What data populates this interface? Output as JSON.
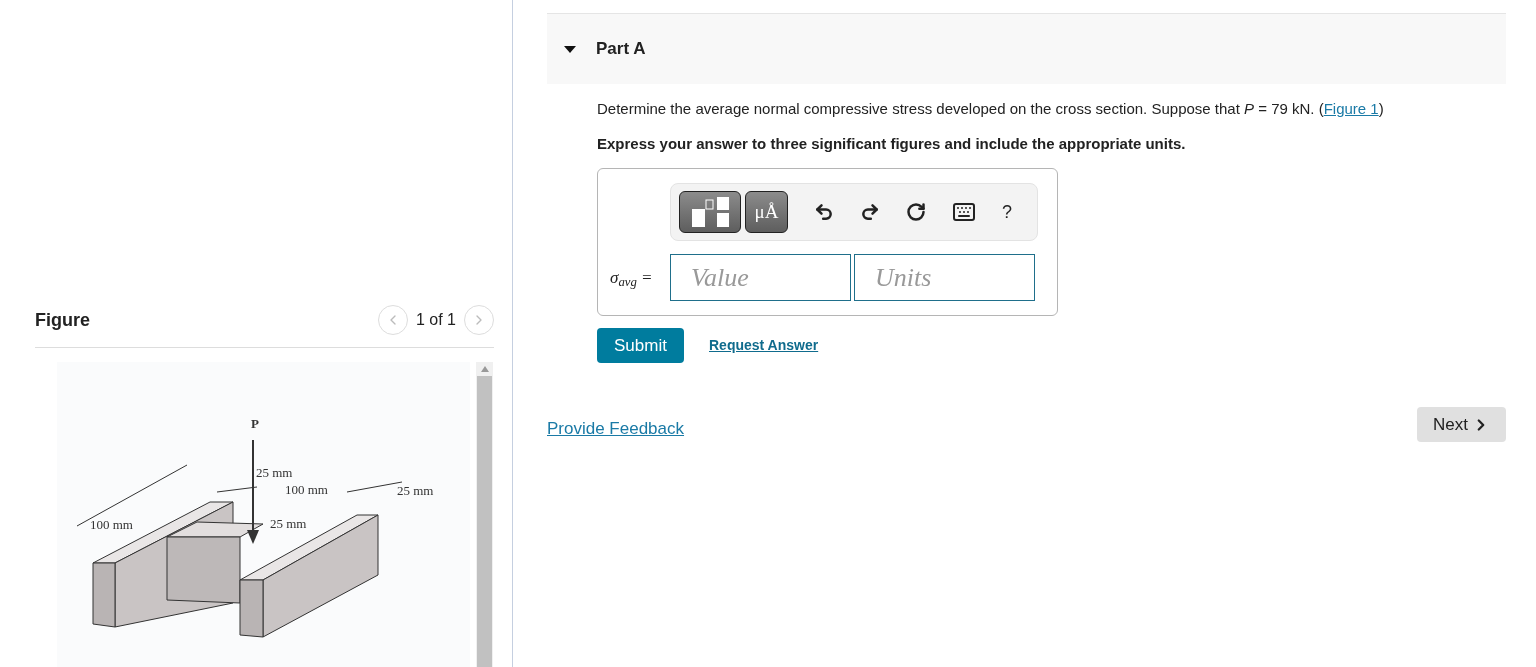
{
  "figure_panel": {
    "title": "Figure",
    "pager": "1 of 1",
    "figure_labels": [
      "P",
      "25 mm",
      "100 mm",
      "25 mm",
      "100 mm",
      "25 mm"
    ]
  },
  "part": {
    "title": "Part A",
    "expanded": true,
    "question": "Determine the average normal compressive stress developed on the cross section. Suppose that *P* = 79 kN. (",
    "figure_link": "Figure 1",
    "question_end": ")",
    "instruction": "Express your answer to three significant figures and include the appropriate units.",
    "toolbar": [
      "μÅ",
      "?"
    ],
    "answer": {
      "label": "σ$_{avg}$ =",
      "value_placeholder": "Value",
      "units_placeholder": "Units"
    },
    "submit": "Submit",
    "request_answer": "Request Answer"
  },
  "feedback_link": "Provide Feedback",
  "next_button": "Next"
}
